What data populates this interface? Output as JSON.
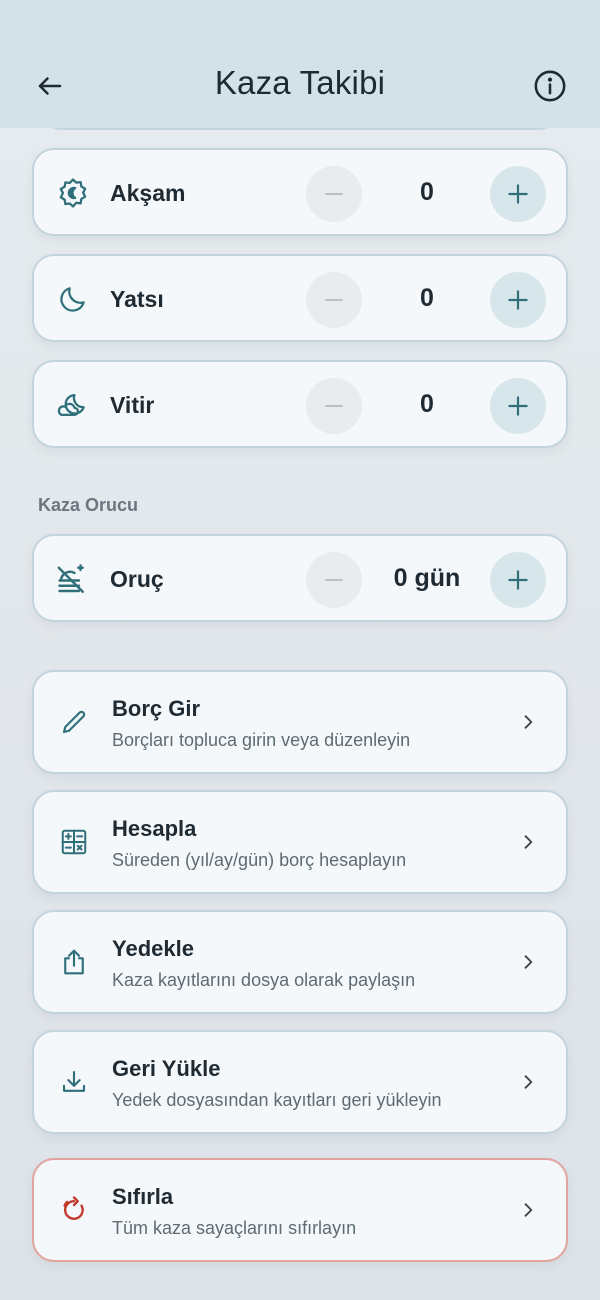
{
  "app_bar": {
    "title": "Kaza Takibi",
    "back_icon": "arrow-left-icon",
    "info_icon": "info-circle-icon"
  },
  "prayers": [
    {
      "label": "Akşam",
      "value": "0",
      "icon": "sunset-moon-icon"
    },
    {
      "label": "Yatsı",
      "value": "0",
      "icon": "moon-icon"
    },
    {
      "label": "Vitir",
      "value": "0",
      "icon": "moon-cloud-icon"
    }
  ],
  "fasting": {
    "section_label": "Kaza Orucu",
    "label": "Oruç",
    "value": "0 gün",
    "icon": "no-food-icon"
  },
  "actions": [
    {
      "title": "Borç Gir",
      "subtitle": "Borçları topluca girin veya düzenleyin",
      "icon": "pencil-icon"
    },
    {
      "title": "Hesapla",
      "subtitle": "Süreden (yıl/ay/gün) borç hesaplayın",
      "icon": "calculator-icon"
    },
    {
      "title": "Yedekle",
      "subtitle": "Kaza kayıtlarını dosya olarak paylaşın",
      "icon": "share-icon"
    },
    {
      "title": "Geri Yükle",
      "subtitle": "Yedek dosyasından kayıtları geri yükleyin",
      "icon": "download-icon"
    },
    {
      "title": "Sıfırla",
      "subtitle": "Tüm kaza sayaçlarını sıfırlayın",
      "icon": "reset-icon"
    }
  ],
  "colors": {
    "accent": "#2f6f7a",
    "danger": "#c0392b",
    "appbar_bg": "#d4e2e8"
  }
}
